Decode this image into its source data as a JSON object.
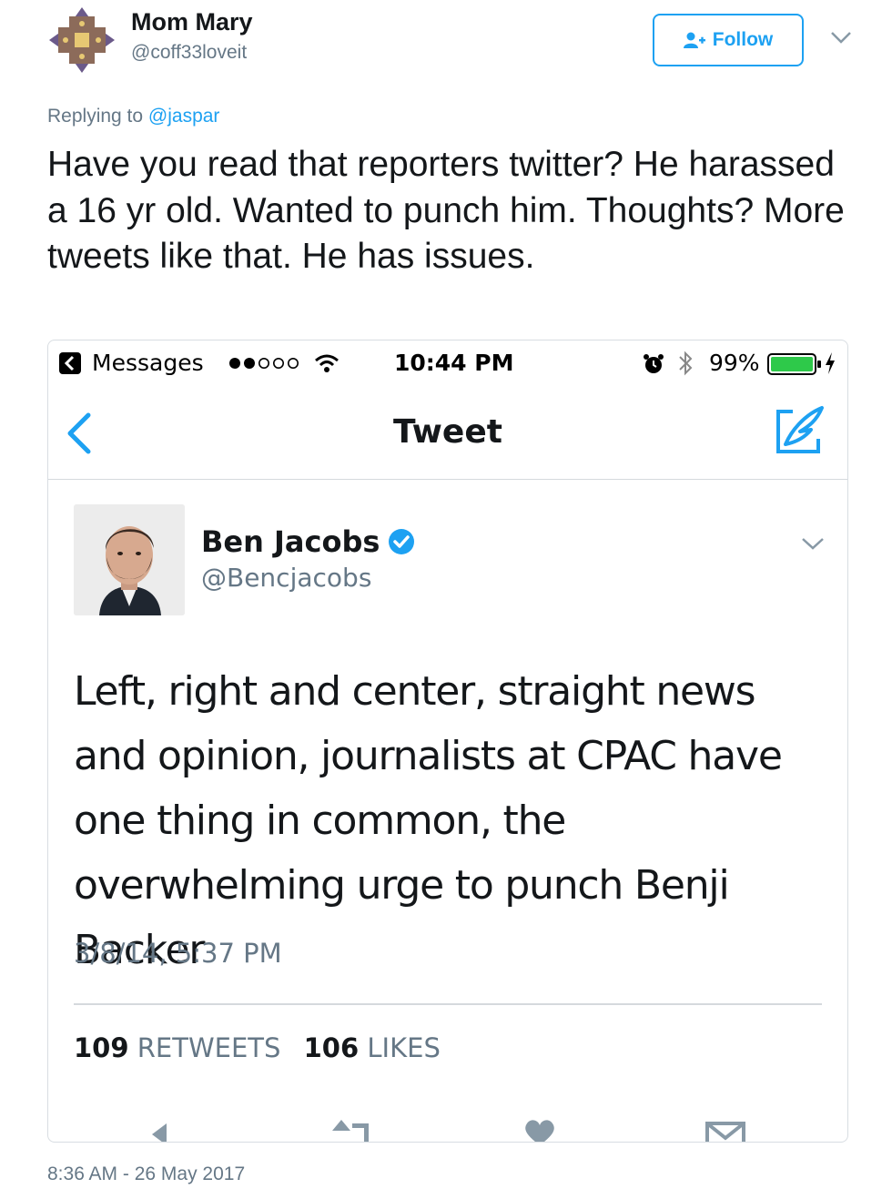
{
  "outer_tweet": {
    "author_name": "Mom Mary",
    "author_handle": "@coff33loveit",
    "follow_label": "Follow",
    "replying_prefix": "Replying to",
    "replying_to": "@jaspar",
    "text": "Have you read that reporters twitter? He harassed a 16 yr old. Wanted to punch him. Thoughts? More tweets like that. He has issues.",
    "timestamp": "8:36 AM - 26 May 2017",
    "icons": [
      "cross-emblem-avatar",
      "follow-person-icon",
      "chevron-down-icon"
    ]
  },
  "embedded_screenshot": {
    "status_bar": {
      "back_app": "Messages",
      "signal": "●●○○○",
      "time": "10:44 PM",
      "battery_pct": "99%",
      "icons": [
        "back-to-app-icon",
        "signal-dots",
        "wifi-icon",
        "alarm-icon",
        "bluetooth-icon",
        "battery-icon",
        "charging-bolt-icon"
      ]
    },
    "nav": {
      "title": "Tweet",
      "icons": [
        "back-chevron-icon",
        "compose-reply-icon"
      ]
    },
    "tweet": {
      "author_name": "Ben Jacobs",
      "author_handle": "@Bencjacobs",
      "verified": true,
      "text": "Left, right and center, straight news and opinion, journalists at CPAC have one thing in common, the overwhelming urge to punch Benji Backer",
      "date": "3/8/14, 5:37 PM",
      "retweets_count": "109",
      "retweets_label": "RETWEETS",
      "likes_count": "106",
      "likes_label": "LIKES",
      "action_icons": [
        "reply-icon",
        "retweet-icon",
        "like-icon",
        "message-icon"
      ]
    }
  },
  "colors": {
    "link_blue": "#1da1f2",
    "text": "#14171a",
    "muted": "#657786",
    "divider": "#d5d9dd",
    "battery_green": "#2ec94a"
  }
}
